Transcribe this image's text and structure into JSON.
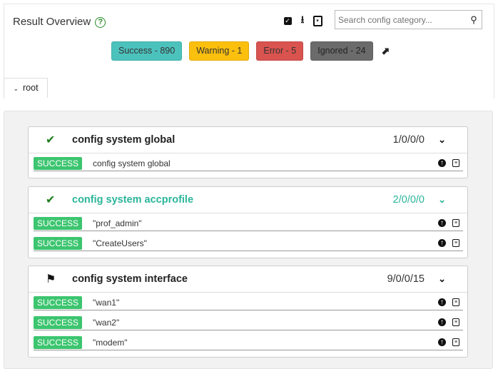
{
  "header": {
    "title": "Result Overview",
    "help_icon": "?",
    "search_placeholder": "Search config category..."
  },
  "summary": [
    {
      "label": "Success - 890",
      "bg": "#4cc2bd"
    },
    {
      "label": "Warning - 1",
      "bg": "#fbbf0e"
    },
    {
      "label": "Error - 5",
      "bg": "#d9534f"
    },
    {
      "label": "Ignored - 24",
      "bg": "#6b6b6b"
    }
  ],
  "root_label": "root",
  "cards": [
    {
      "title": "config system global",
      "counts": "1/0/0/0",
      "rows": [
        {
          "status": "SUCCESS",
          "text": "config system global"
        }
      ]
    },
    {
      "title": "config system accprofile",
      "counts": "2/0/0/0",
      "rows": [
        {
          "status": "SUCCESS",
          "text": "\"prof_admin\""
        },
        {
          "status": "SUCCESS",
          "text": "\"CreateUsers\""
        }
      ]
    },
    {
      "title": "config system interface",
      "counts": "9/0/0/15",
      "rows": [
        {
          "status": "SUCCESS",
          "text": "\"wan1\""
        },
        {
          "status": "SUCCESS",
          "text": "\"wan2\""
        },
        {
          "status": "SUCCESS",
          "text": "\"modem\""
        }
      ]
    }
  ]
}
